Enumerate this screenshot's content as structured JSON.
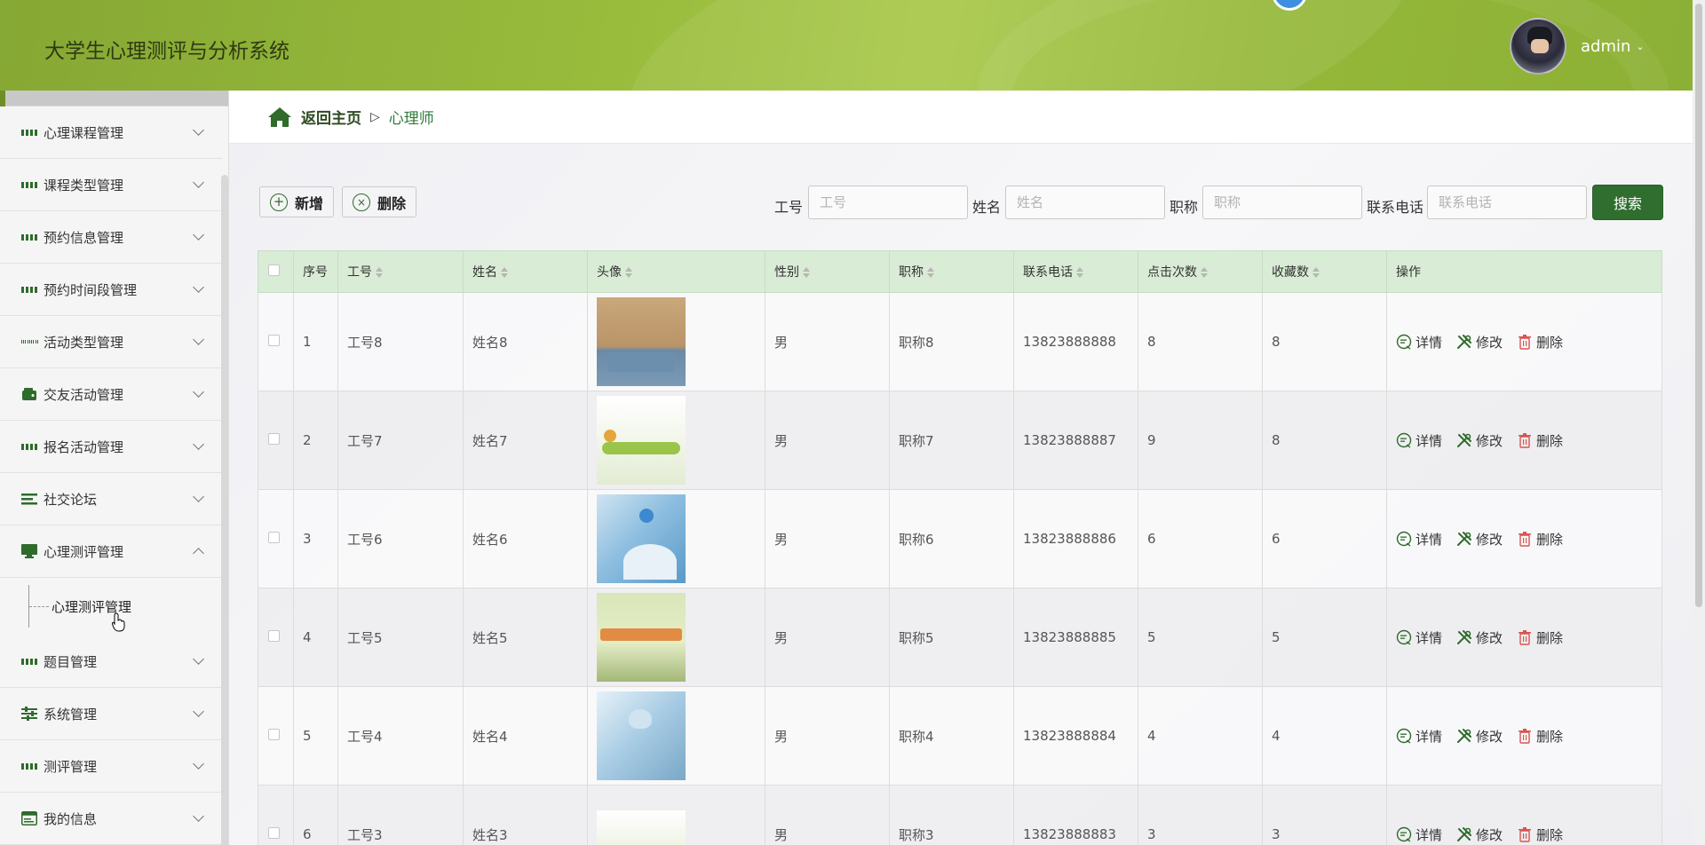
{
  "header": {
    "app_title": "大学生心理测评与分析系统",
    "user_name": "admin"
  },
  "sidebar": {
    "items": [
      {
        "label": "心理课程管理",
        "icon": "grid-icon",
        "expanded": false
      },
      {
        "label": "课程类型管理",
        "icon": "grid-icon",
        "expanded": false
      },
      {
        "label": "预约信息管理",
        "icon": "grid-icon",
        "expanded": false
      },
      {
        "label": "预约时间段管理",
        "icon": "grid-icon",
        "expanded": false
      },
      {
        "label": "活动类型管理",
        "icon": "grid9-icon",
        "expanded": false
      },
      {
        "label": "交友活动管理",
        "icon": "wallet-icon",
        "expanded": false
      },
      {
        "label": "报名活动管理",
        "icon": "grid-icon",
        "expanded": false
      },
      {
        "label": "社交论坛",
        "icon": "list-icon",
        "expanded": false
      },
      {
        "label": "心理测评管理",
        "icon": "monitor-icon",
        "expanded": true
      },
      {
        "label": "题目管理",
        "icon": "grid-icon",
        "expanded": false
      },
      {
        "label": "系统管理",
        "icon": "sliders-icon",
        "expanded": false
      },
      {
        "label": "测评管理",
        "icon": "grid-icon",
        "expanded": false
      },
      {
        "label": "我的信息",
        "icon": "id-card-icon",
        "expanded": false
      }
    ],
    "submenu": {
      "label": "心理测评管理"
    }
  },
  "breadcrumb": {
    "home": "返回主页",
    "separator": "▷",
    "current": "心理师"
  },
  "toolbar": {
    "add_label": "新增",
    "delete_label": "删除"
  },
  "search": {
    "fields": [
      {
        "label": "工号",
        "placeholder": "工号",
        "value": ""
      },
      {
        "label": "姓名",
        "placeholder": "姓名",
        "value": ""
      },
      {
        "label": "职称",
        "placeholder": "职称",
        "value": ""
      },
      {
        "label": "联系电话",
        "placeholder": "联系电话",
        "value": ""
      }
    ],
    "button_label": "搜索"
  },
  "table": {
    "columns": [
      "序号",
      "工号",
      "姓名",
      "头像",
      "性别",
      "职称",
      "联系电话",
      "点击次数",
      "收藏数",
      "操作"
    ],
    "rows": [
      {
        "index": "1",
        "staff_no": "工号8",
        "name": "姓名8",
        "gender": "男",
        "title": "职称8",
        "phone": "13823888888",
        "clicks": "8",
        "favorites": "8"
      },
      {
        "index": "2",
        "staff_no": "工号7",
        "name": "姓名7",
        "gender": "男",
        "title": "职称7",
        "phone": "13823888887",
        "clicks": "9",
        "favorites": "8"
      },
      {
        "index": "3",
        "staff_no": "工号6",
        "name": "姓名6",
        "gender": "男",
        "title": "职称6",
        "phone": "13823888886",
        "clicks": "6",
        "favorites": "6"
      },
      {
        "index": "4",
        "staff_no": "工号5",
        "name": "姓名5",
        "gender": "男",
        "title": "职称5",
        "phone": "13823888885",
        "clicks": "5",
        "favorites": "5"
      },
      {
        "index": "5",
        "staff_no": "工号4",
        "name": "姓名4",
        "gender": "男",
        "title": "职称4",
        "phone": "13823888884",
        "clicks": "4",
        "favorites": "4"
      },
      {
        "index": "6",
        "staff_no": "工号3",
        "name": "姓名3",
        "gender": "男",
        "title": "职称3",
        "phone": "13823888883",
        "clicks": "3",
        "favorites": "3"
      }
    ],
    "actions": {
      "detail": "详情",
      "edit": "修改",
      "delete": "删除"
    }
  },
  "colors": {
    "primary": "#2f6e2e",
    "header_green": "#98bb3c",
    "table_header": "#d9ecd5",
    "delete_red": "#d9534f"
  }
}
